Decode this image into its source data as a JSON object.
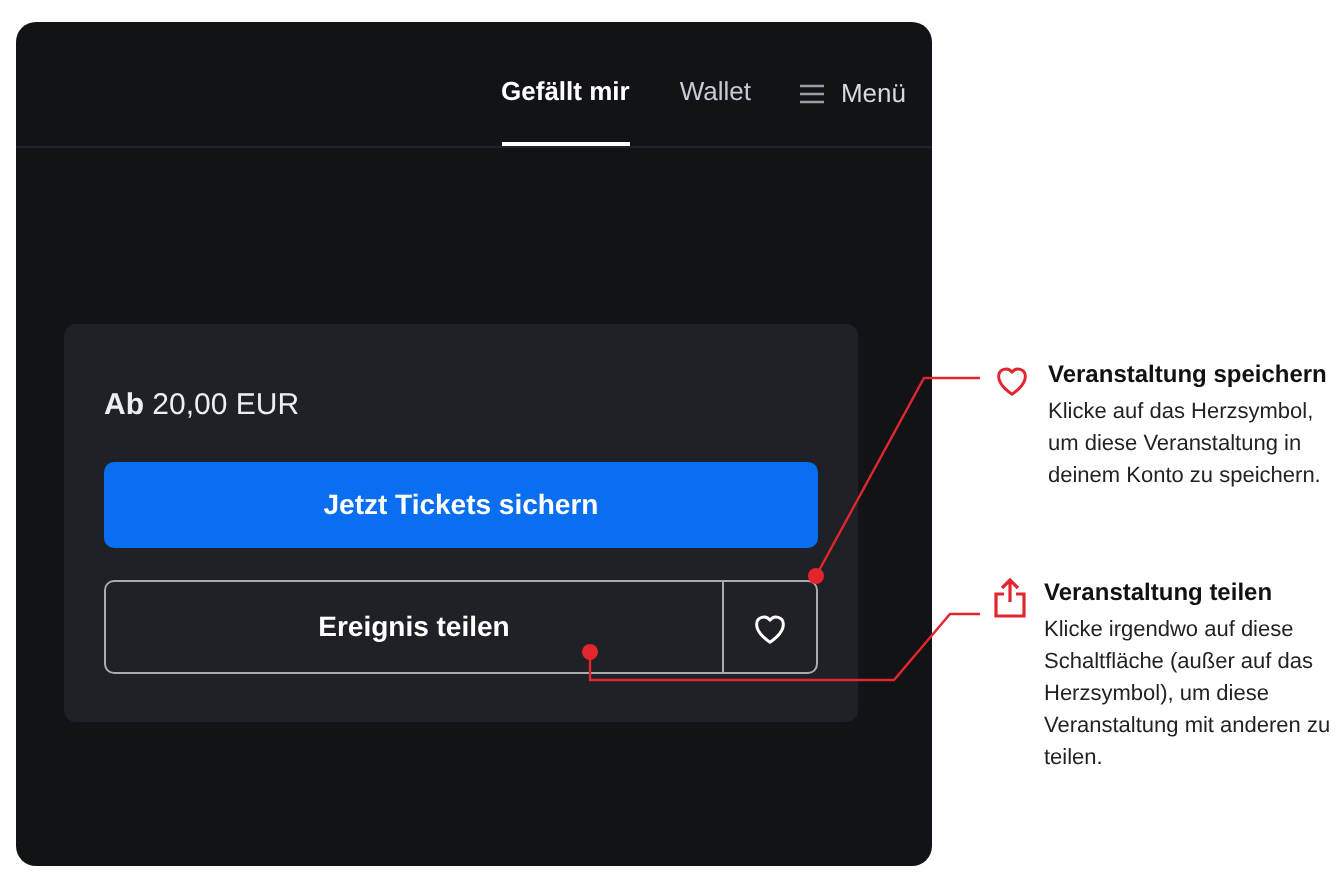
{
  "nav": [
    {
      "label": "Gefällt mir",
      "selected": true,
      "kind": "tab"
    },
    {
      "label": "Wallet",
      "selected": false,
      "kind": "tab"
    },
    {
      "label": "Menü",
      "kind": "menu"
    }
  ],
  "card": {
    "price": "**Ab** 20,00 EUR",
    "primary_button": "Jetzt Tickets sichern",
    "share_button": "Ereignis teilen"
  },
  "annotations": [
    {
      "kind": "heart",
      "title": "Veranstaltung speichern",
      "text": "Klicke auf das Herzsymbol, um diese Veranstaltung in deinem Konto zu speichern."
    },
    {
      "kind": "share",
      "title": "Veranstaltung teilen",
      "text": "Klicke irgendwo auf diese Schaltfläche (außer auf das Herzsymbol), um diese Veranstaltung mit anderen zu teilen."
    }
  ]
}
